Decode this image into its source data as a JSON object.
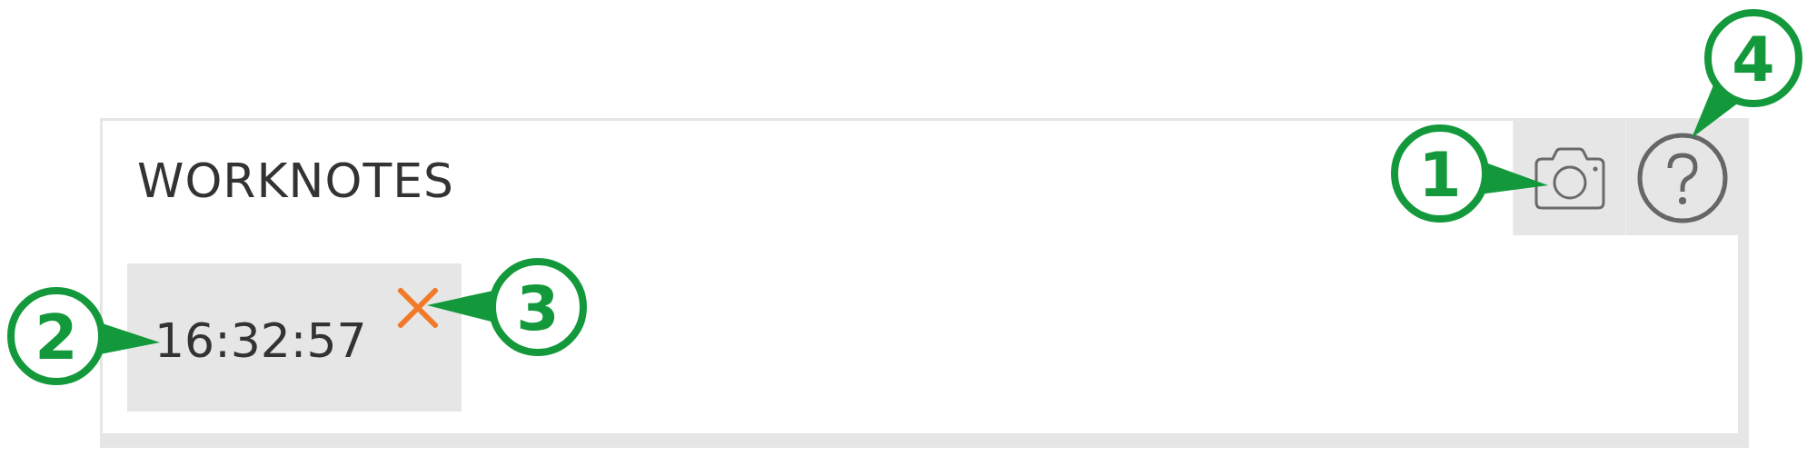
{
  "panel": {
    "title": "WORKNOTES",
    "toolbar": [
      {
        "kind": "camera"
      },
      {
        "kind": "help"
      }
    ],
    "entries": [
      {
        "time": "16:32:57"
      }
    ]
  },
  "callouts": [
    {
      "number": "1"
    },
    {
      "number": "2"
    },
    {
      "number": "3"
    },
    {
      "number": "4"
    }
  ]
}
